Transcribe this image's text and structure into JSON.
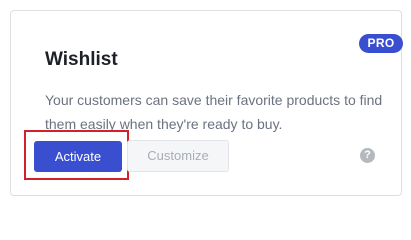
{
  "card": {
    "badge": "PRO",
    "title": "Wishlist",
    "description": "Your customers can save their favorite products to find them easily when they're ready to buy.",
    "buttons": {
      "activate_label": "Activate",
      "customize_label": "Customize"
    },
    "help_icon": "question-circle-icon",
    "help_glyph": "?"
  },
  "colors": {
    "accent": "#3a4fd0",
    "highlight": "#d1212a",
    "muted_text": "#6b7280",
    "disabled_text": "#a8adb6"
  }
}
